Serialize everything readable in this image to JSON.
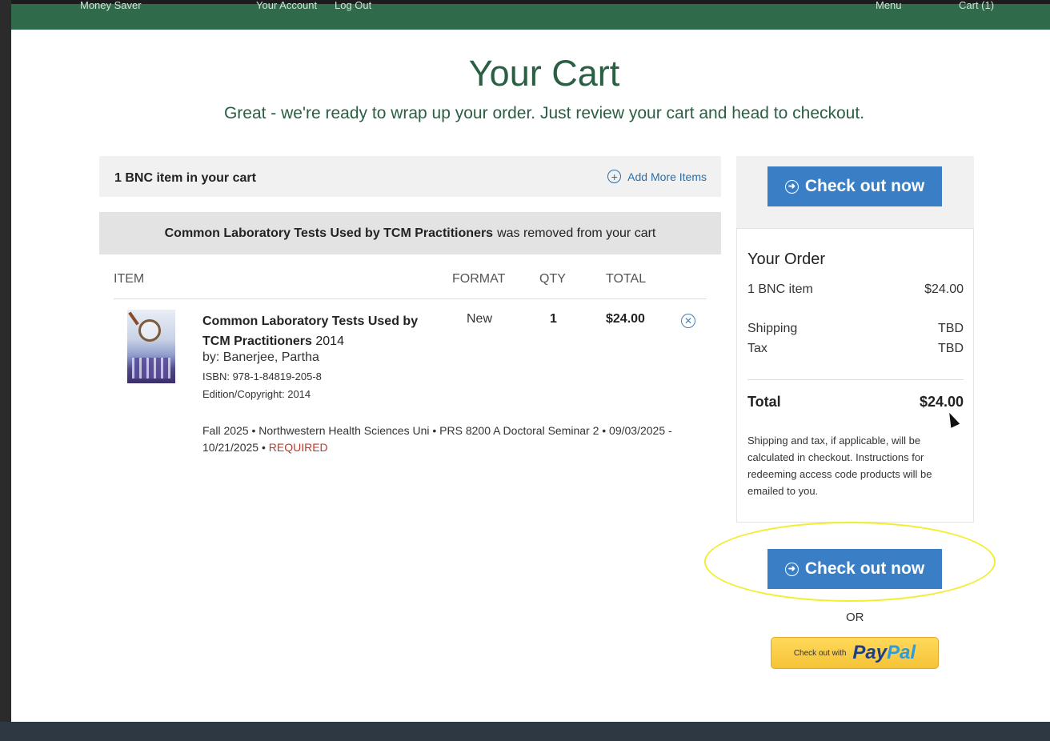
{
  "nav": {
    "left_items": [
      "Money Saver",
      "Your Account",
      "Log Out"
    ],
    "right_items": [
      "Menu",
      "Cart (1)"
    ]
  },
  "page": {
    "title": "Your Cart",
    "subtitle": "Great - we're ready to wrap up your order. Just review your cart and head to checkout."
  },
  "cart": {
    "count_label": "1 BNC item in your cart",
    "add_more_label": "Add More Items",
    "removed_notice": {
      "title": "Common Laboratory Tests Used by TCM Practitioners",
      "suffix": "was removed from your cart"
    },
    "columns": {
      "item": "ITEM",
      "format": "FORMAT",
      "qty": "QTY",
      "total": "TOTAL"
    },
    "item": {
      "title": "Common Laboratory Tests Used by TCM Practitioners",
      "year": "2014",
      "author": "by: Banerjee, Partha",
      "isbn": "ISBN: 978-1-84819-205-8",
      "edition": "Edition/Copyright: 2014",
      "format": "New",
      "qty": "1",
      "total": "$24.00",
      "course": "Fall 2025 • Northwestern Health Sciences Uni • PRS 8200 A Doctoral Seminar 2 • 09/03/2025 - 10/21/2025 •",
      "required": "REQUIRED"
    }
  },
  "summary": {
    "checkout_label": "Check out now",
    "title": "Your Order",
    "items_label": "1 BNC item",
    "items_value": "$24.00",
    "shipping_label": "Shipping",
    "shipping_value": "TBD",
    "tax_label": "Tax",
    "tax_value": "TBD",
    "total_label": "Total",
    "total_value": "$24.00",
    "note": "Shipping and tax, if applicable, will be calculated in checkout. Instructions for redeeming access code products will be emailed to you."
  },
  "alt_checkout": {
    "or_label": "OR",
    "paypal_prefix": "Check out with",
    "paypal_brand_1": "Pay",
    "paypal_brand_2": "Pal"
  },
  "colors": {
    "brand_green": "#2a5f43",
    "nav_green": "#2f6b4a",
    "button_blue": "#3a7fc6",
    "required_red": "#c0392b",
    "highlight_yellow": "#f2ee2f"
  }
}
